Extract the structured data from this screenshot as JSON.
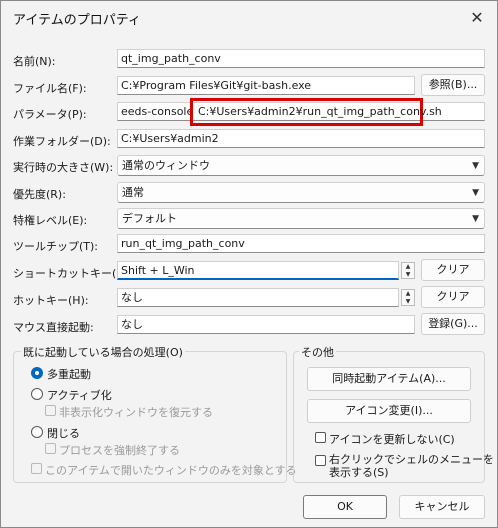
{
  "dialog": {
    "title": "アイテムのプロパティ",
    "close_glyph": "✕"
  },
  "fields": {
    "name": {
      "label": "名前(N):",
      "value": "qt_img_path_conv"
    },
    "filename": {
      "label": "ファイル名(F):",
      "value": "C:¥Program Files¥Git¥git-bash.exe",
      "button": "参照(B)..."
    },
    "params": {
      "label": "パラメータ(P):",
      "value_prefix": "eeds-console",
      "value_highlight": "C:¥Users¥admin2¥run_qt_img_path_conv.sh"
    },
    "workdir": {
      "label": "作業フォルダー(D):",
      "value": "C:¥Users¥admin2"
    },
    "window_size": {
      "label": "実行時の大きさ(W):",
      "value": "通常のウィンドウ"
    },
    "priority": {
      "label": "優先度(R):",
      "value": "通常"
    },
    "privilege": {
      "label": "特権レベル(E):",
      "value": "デフォルト"
    },
    "tooltip": {
      "label": "ツールチップ(T):",
      "value": "run_qt_img_path_conv"
    },
    "shortcut": {
      "label": "ショートカットキー(K):",
      "value": "Shift + L_Win",
      "button": "クリア"
    },
    "hotkey": {
      "label": "ホットキー(H):",
      "value": "なし",
      "button": "クリア"
    },
    "mouse": {
      "label": "マウス直接起動:",
      "value": "なし",
      "button": "登録(G)..."
    }
  },
  "already_running": {
    "title": "既に起動している場合の処理(O)",
    "multi": "多重起動",
    "activate": "アクティブ化",
    "restore_hidden": "非表示化ウィンドウを復元する",
    "close": "閉じる",
    "force_kill": "プロセスを強制終了する",
    "only_this": "このアイテムで開いたウィンドウのみを対象とする"
  },
  "other": {
    "title": "その他",
    "simul_button": "同時起動アイテム(A)...",
    "icon_change_button": "アイコン変更(I)...",
    "no_icon_update": "アイコンを更新しない(C)",
    "shell_menu_line1": "右クリックでシェルのメニューを",
    "shell_menu_line2": "表示する(S)"
  },
  "footer": {
    "ok": "OK",
    "cancel": "キャンセル"
  },
  "colors": {
    "accent": "#0067c0",
    "highlight_border": "#d90000"
  },
  "icons": {
    "close": "close-icon",
    "chevron": "chevron-down-icon",
    "spin": "spinner-icon"
  }
}
